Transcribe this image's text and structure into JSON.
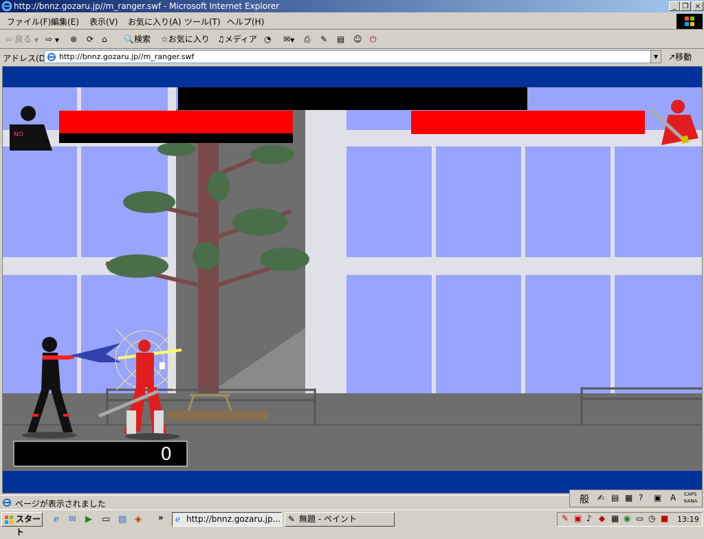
{
  "window": {
    "title": "http://bnnz.gozaru.jp//m_ranger.swf - Microsoft Internet Explorer",
    "minimize": "_",
    "restore": "❐",
    "close": "×"
  },
  "menu": [
    "ファイル(F)",
    "編集(E)",
    "表示(V)",
    "お気に入り(A)",
    "ツール(T)",
    "ヘルプ(H)"
  ],
  "toolbar": {
    "back": "戻る",
    "search": "検索",
    "favorites": "お気に入り",
    "media": "メディア"
  },
  "address": {
    "label": "アドレス(D)",
    "url": "http://bnnz.gozaru.jp//m_ranger.swf",
    "go": "移動"
  },
  "game": {
    "player_badge": "NO",
    "score": "0",
    "player_health": 1.0,
    "enemy_health": 1.0,
    "colors": {
      "frame": "#003399",
      "health": "#ff0000",
      "sky_window": "#99a4ff",
      "tree_leaves": "#4a6e4a",
      "ranger_red": "#e01e1e"
    }
  },
  "status": {
    "text": "ページが表示されました",
    "ime_mode": "般",
    "caps": "CAPS",
    "kana": "KANA"
  },
  "taskbar": {
    "start": "スタート",
    "more": "»",
    "tasks": [
      "http://bnnz.gozaru.jp...",
      "無題 - ペイント"
    ],
    "clock": "13:19"
  }
}
